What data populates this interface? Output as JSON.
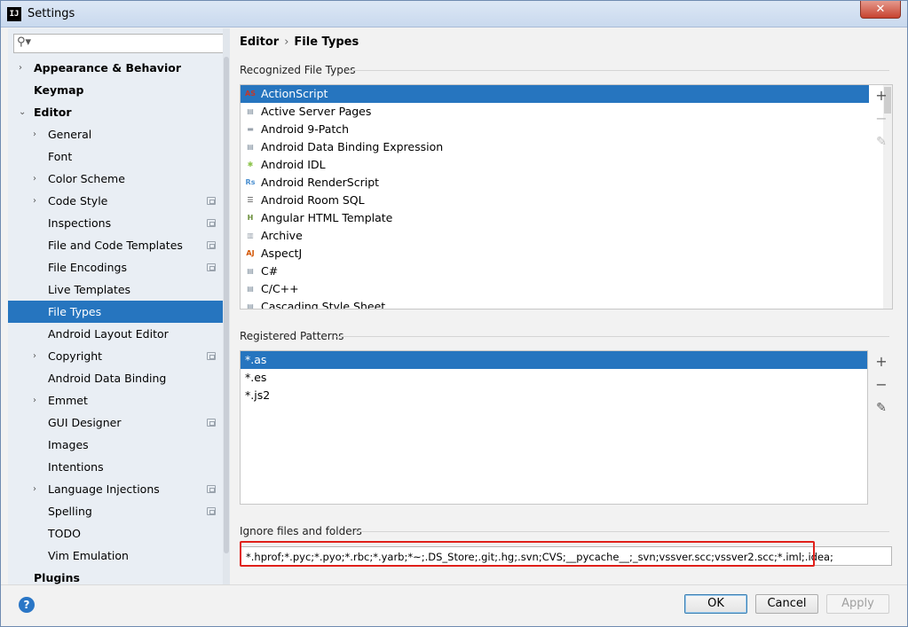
{
  "window": {
    "title": "Settings",
    "app_icon_text": "IJ",
    "close_glyph": "✕"
  },
  "search": {
    "placeholder": "",
    "value": ""
  },
  "sidebar": {
    "items": [
      {
        "label": "Appearance & Behavior",
        "level": 0,
        "bold": true,
        "arrow": "›",
        "scope": false,
        "selected": false
      },
      {
        "label": "Keymap",
        "level": 0,
        "bold": true,
        "arrow": "",
        "scope": false,
        "selected": false
      },
      {
        "label": "Editor",
        "level": 0,
        "bold": true,
        "arrow": "⌄",
        "scope": false,
        "selected": false
      },
      {
        "label": "General",
        "level": 1,
        "bold": false,
        "arrow": "›",
        "scope": false,
        "selected": false
      },
      {
        "label": "Font",
        "level": 1,
        "bold": false,
        "arrow": "",
        "scope": false,
        "selected": false
      },
      {
        "label": "Color Scheme",
        "level": 1,
        "bold": false,
        "arrow": "›",
        "scope": false,
        "selected": false
      },
      {
        "label": "Code Style",
        "level": 1,
        "bold": false,
        "arrow": "›",
        "scope": true,
        "selected": false
      },
      {
        "label": "Inspections",
        "level": 1,
        "bold": false,
        "arrow": "",
        "scope": true,
        "selected": false
      },
      {
        "label": "File and Code Templates",
        "level": 1,
        "bold": false,
        "arrow": "",
        "scope": true,
        "selected": false
      },
      {
        "label": "File Encodings",
        "level": 1,
        "bold": false,
        "arrow": "",
        "scope": true,
        "selected": false
      },
      {
        "label": "Live Templates",
        "level": 1,
        "bold": false,
        "arrow": "",
        "scope": false,
        "selected": false
      },
      {
        "label": "File Types",
        "level": 1,
        "bold": false,
        "arrow": "",
        "scope": false,
        "selected": true
      },
      {
        "label": "Android Layout Editor",
        "level": 1,
        "bold": false,
        "arrow": "",
        "scope": false,
        "selected": false
      },
      {
        "label": "Copyright",
        "level": 1,
        "bold": false,
        "arrow": "›",
        "scope": true,
        "selected": false
      },
      {
        "label": "Android Data Binding",
        "level": 1,
        "bold": false,
        "arrow": "",
        "scope": false,
        "selected": false
      },
      {
        "label": "Emmet",
        "level": 1,
        "bold": false,
        "arrow": "›",
        "scope": false,
        "selected": false
      },
      {
        "label": "GUI Designer",
        "level": 1,
        "bold": false,
        "arrow": "",
        "scope": true,
        "selected": false
      },
      {
        "label": "Images",
        "level": 1,
        "bold": false,
        "arrow": "",
        "scope": false,
        "selected": false
      },
      {
        "label": "Intentions",
        "level": 1,
        "bold": false,
        "arrow": "",
        "scope": false,
        "selected": false
      },
      {
        "label": "Language Injections",
        "level": 1,
        "bold": false,
        "arrow": "›",
        "scope": true,
        "selected": false
      },
      {
        "label": "Spelling",
        "level": 1,
        "bold": false,
        "arrow": "",
        "scope": true,
        "selected": false
      },
      {
        "label": "TODO",
        "level": 1,
        "bold": false,
        "arrow": "",
        "scope": false,
        "selected": false
      },
      {
        "label": "Vim Emulation",
        "level": 1,
        "bold": false,
        "arrow": "",
        "scope": false,
        "selected": false
      },
      {
        "label": "Plugins",
        "level": 0,
        "bold": true,
        "arrow": "",
        "scope": false,
        "selected": false
      }
    ]
  },
  "breadcrumb": {
    "parent": "Editor",
    "separator": "›",
    "current": "File Types"
  },
  "recognized": {
    "title": "Recognized File Types",
    "items": [
      {
        "label": "ActionScript",
        "icon": "actionscript-icon",
        "glyph": "AS",
        "color": "#c0392b",
        "selected": true
      },
      {
        "label": "Active Server Pages",
        "icon": "asp-file-icon",
        "glyph": "▤",
        "color": "#7a8a99",
        "selected": false
      },
      {
        "label": "Android 9-Patch",
        "icon": "folder-icon",
        "glyph": "▬",
        "color": "#9aa3ad",
        "selected": false
      },
      {
        "label": "Android Data Binding Expression",
        "icon": "data-binding-icon",
        "glyph": "▤",
        "color": "#7a8a99",
        "selected": false
      },
      {
        "label": "Android IDL",
        "icon": "android-icon",
        "glyph": "✱",
        "color": "#8bc34a",
        "selected": false
      },
      {
        "label": "Android RenderScript",
        "icon": "renderscript-icon",
        "glyph": "Rs",
        "color": "#4a8fd0",
        "selected": false
      },
      {
        "label": "Android Room SQL",
        "icon": "database-icon",
        "glyph": "☰",
        "color": "#444444",
        "selected": false
      },
      {
        "label": "Angular HTML Template",
        "icon": "html-file-icon",
        "glyph": "H",
        "color": "#6a8f3a",
        "selected": false
      },
      {
        "label": "Archive",
        "icon": "archive-icon",
        "glyph": "▥",
        "color": "#9aa3ad",
        "selected": false
      },
      {
        "label": "AspectJ",
        "icon": "aspectj-icon",
        "glyph": "AJ",
        "color": "#d35400",
        "selected": false
      },
      {
        "label": "C#",
        "icon": "csharp-file-icon",
        "glyph": "▤",
        "color": "#7a8a99",
        "selected": false
      },
      {
        "label": "C/C++",
        "icon": "cpp-file-icon",
        "glyph": "▤",
        "color": "#7a8a99",
        "selected": false
      },
      {
        "label": "Cascading Style Sheet",
        "icon": "css-file-icon",
        "glyph": "▤",
        "color": "#7a8a99",
        "selected": false
      }
    ],
    "add": "+",
    "remove": "−",
    "edit": "✎"
  },
  "patterns": {
    "title": "Registered Patterns",
    "items": [
      {
        "label": "*.as",
        "selected": true
      },
      {
        "label": "*.es",
        "selected": false
      },
      {
        "label": "*.js2",
        "selected": false
      }
    ],
    "add": "+",
    "remove": "−",
    "edit": "✎"
  },
  "ignore": {
    "title": "Ignore files and folders",
    "value": "*.hprof;*.pyc;*.pyo;*.rbc;*.yarb;*~;.DS_Store;.git;.hg;.svn;CVS;__pycache__;_svn;vssver.scc;vssver2.scc;*.iml;.idea;"
  },
  "footer": {
    "help": "?",
    "ok": "OK",
    "cancel": "Cancel",
    "apply": "Apply"
  },
  "colors": {
    "selection": "#2675bf",
    "highlight": "#e0201a"
  }
}
